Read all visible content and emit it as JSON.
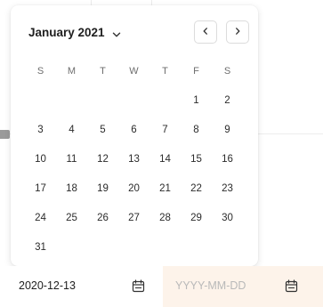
{
  "calendar": {
    "month_label": "January 2021",
    "weekdays": [
      "S",
      "M",
      "T",
      "W",
      "T",
      "F",
      "S"
    ],
    "weeks": [
      [
        "",
        "",
        "",
        "",
        "",
        "1",
        "2"
      ],
      [
        "3",
        "4",
        "5",
        "6",
        "7",
        "8",
        "9"
      ],
      [
        "10",
        "11",
        "12",
        "13",
        "14",
        "15",
        "16"
      ],
      [
        "17",
        "18",
        "19",
        "20",
        "21",
        "22",
        "23"
      ],
      [
        "24",
        "25",
        "26",
        "27",
        "28",
        "29",
        "30"
      ],
      [
        "31",
        "",
        "",
        "",
        "",
        "",
        ""
      ]
    ]
  },
  "date_range": {
    "start_value": "2020-12-13",
    "end_placeholder": "YYYY-MM-DD"
  },
  "icons": {
    "month_toggle": "chevron-down-icon",
    "prev": "chevron-left-icon",
    "next": "chevron-right-icon",
    "start_calendar": "calendar-icon",
    "end_calendar": "calendar-icon"
  },
  "colors": {
    "end_field_bg": "#fdf3ea",
    "text": "#202020",
    "placeholder": "#b9b9b9"
  }
}
